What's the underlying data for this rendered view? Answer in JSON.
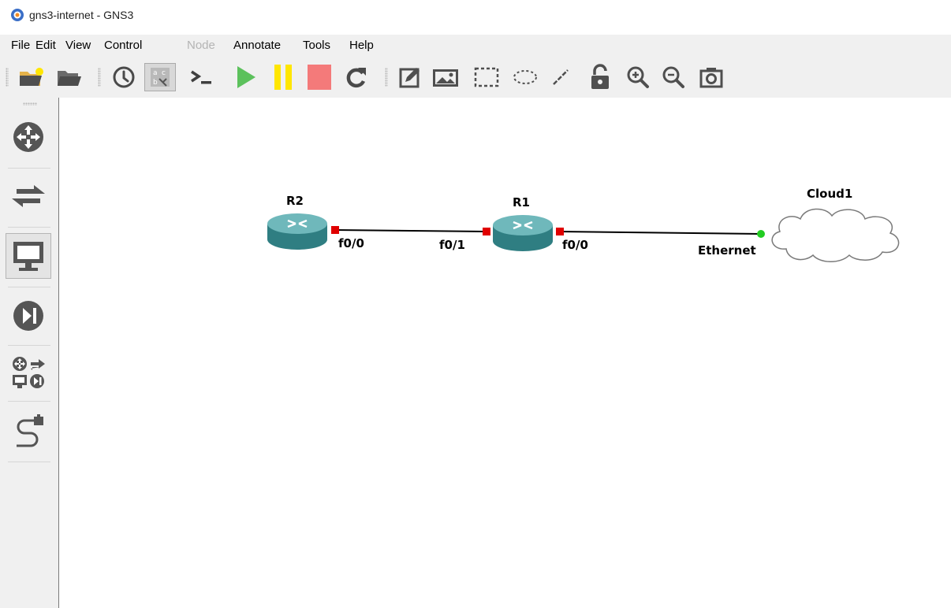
{
  "window": {
    "title": "gns3-internet - GNS3"
  },
  "menu": {
    "file": "File",
    "edit": "Edit",
    "view": "View",
    "control": "Control",
    "node": "Node",
    "annotate": "Annotate",
    "tools": "Tools",
    "help": "Help"
  },
  "toolbar": {
    "icons": [
      "new-project-icon",
      "open-project-icon",
      "snapshot-icon",
      "show-interface-labels-icon",
      "console-icon",
      "start-icon",
      "suspend-icon",
      "stop-icon",
      "reload-icon",
      "add-note-icon",
      "insert-picture-icon",
      "draw-rectangle-icon",
      "draw-ellipse-icon",
      "draw-line-icon",
      "lock-icon",
      "zoom-in-icon",
      "zoom-out-icon",
      "screenshot-icon"
    ],
    "colors": {
      "start": "#5cc15c",
      "suspend": "#ffe600",
      "stop": "#f47a7a"
    }
  },
  "sidebar": {
    "items": [
      "routers-icon",
      "switches-icon",
      "end-devices-icon",
      "security-devices-icon",
      "all-devices-icon",
      "add-link-icon"
    ],
    "selected": "end-devices-icon"
  },
  "topology": {
    "nodes": {
      "r2": "R2",
      "r1": "R1",
      "cloud": "Cloud1"
    },
    "ports": {
      "r2_f00": "f0/0",
      "r1_f01": "f0/1",
      "r1_f00": "f0/0",
      "cloud_eth": "Ethernet"
    },
    "port_colors": {
      "down": "#e00000",
      "up": "#22cc22"
    }
  },
  "annotation": {
    "arrow_color": "#1a9c7c",
    "target": "add-link-icon"
  }
}
